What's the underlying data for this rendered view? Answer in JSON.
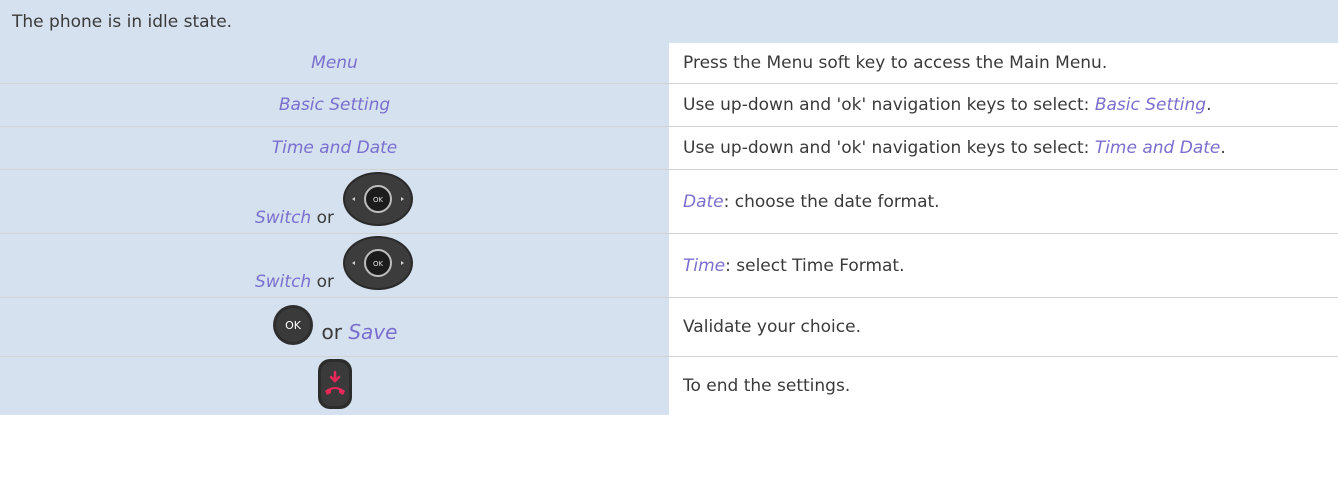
{
  "header": {
    "text": "The phone is in idle state."
  },
  "rows": [
    {
      "key": "Menu",
      "desc": "Press the Menu soft key to access the Main Menu."
    },
    {
      "key": "Basic Setting",
      "desc_prefix": "Use up-down and 'ok' navigation keys to select: ",
      "desc_italic": "Basic Setting",
      "desc_suffix": "."
    },
    {
      "key": "Time and Date",
      "desc_prefix": "Use up-down and 'ok' navigation keys to select: ",
      "desc_italic": "Time and Date",
      "desc_suffix": "."
    },
    {
      "key_italic": "Switch",
      "key_or": "or",
      "key_icon": "navigation-pad-icon",
      "desc_italic": "Date",
      "desc_suffix": ": choose the date format."
    },
    {
      "key_italic": "Switch",
      "key_or": "or",
      "key_icon": "navigation-pad-icon",
      "desc_italic": "Time",
      "desc_suffix": ": select Time Format."
    },
    {
      "key_icon": "ok-key-icon",
      "key_icon_label": "OK",
      "key_or": "or",
      "key_italic": "Save",
      "desc": "Validate your choice."
    },
    {
      "key_icon": "hang-up-key-icon",
      "desc": "To end the settings."
    }
  ],
  "colors": {
    "header_bg": "#d5e1ee",
    "key_bg": "#d5e1ee",
    "italic_text": "#7a6fcf",
    "body_text": "#3a3a3a",
    "hangup_red": "#e8285a"
  }
}
